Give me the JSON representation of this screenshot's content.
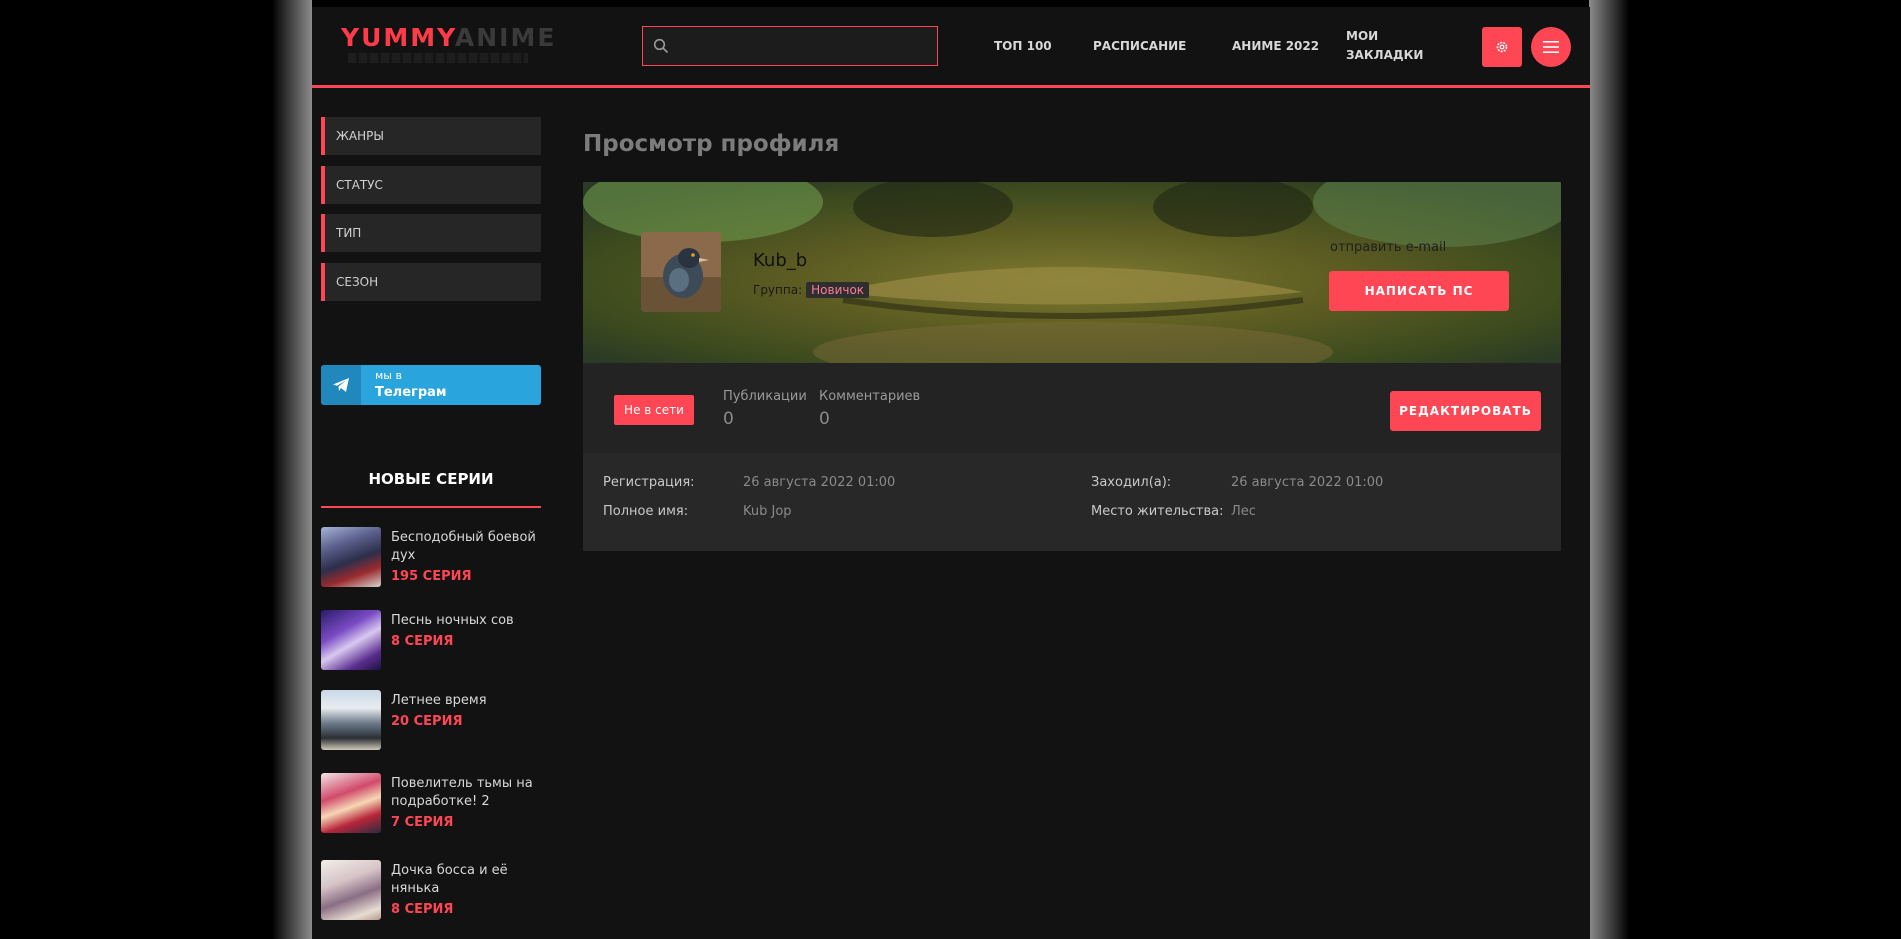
{
  "header": {
    "logo_part1": "YUMMY",
    "logo_part2": "ANIME",
    "search_placeholder": "",
    "nav": [
      "ТОП 100",
      "РАСПИСАНИЕ",
      "АНИМЕ 2022"
    ],
    "bookmarks_line1": "МОИ",
    "bookmarks_line2": "ЗАКЛАДКИ",
    "settings_icon": "gear-icon",
    "menu_icon": "hamburger-icon"
  },
  "sidebar": {
    "items": [
      "ЖАНРЫ",
      "СТАТУС",
      "ТИП",
      "СЕЗОН"
    ],
    "telegram_line1": "мы в",
    "telegram_line2": "Телеграм",
    "new_series_title": "НОВЫЕ СЕРИИ",
    "episodes": [
      {
        "title": "Бесподобный боевой дух",
        "episode": "195 СЕРИЯ"
      },
      {
        "title": "Песнь ночных сов",
        "episode": "8 СЕРИЯ"
      },
      {
        "title": "Летнее время",
        "episode": "20 СЕРИЯ"
      },
      {
        "title": "Повелитель тьмы на подработке! 2",
        "episode": "7 СЕРИЯ"
      },
      {
        "title": "Дочка босса и её нянька",
        "episode": "8 СЕРИЯ"
      }
    ]
  },
  "profile": {
    "page_title": "Просмотр профиля",
    "username": "Kub_b",
    "group_label": "Группа:",
    "group_value": "Новичок",
    "email_link": "отправить e-mail",
    "write_pm": "НАПИСАТЬ ПС",
    "status": "Не в сети",
    "publications_label": "Публикации",
    "publications_value": "0",
    "comments_label": "Комментариев",
    "comments_value": "0",
    "edit": "РЕДАКТИРОВАТЬ",
    "registration_label": "Регистрация:",
    "registration_value": "26 августа 2022 01:00",
    "visited_label": "Заходил(а):",
    "visited_value": "26 августа 2022 01:00",
    "fullname_label": "Полное имя:",
    "fullname_value": "Kub Jop",
    "location_label": "Место жительства:",
    "location_value": "Лес"
  },
  "colors": {
    "accent": "#ff4654",
    "telegram": "#2aa4dc",
    "background": "#121212"
  }
}
